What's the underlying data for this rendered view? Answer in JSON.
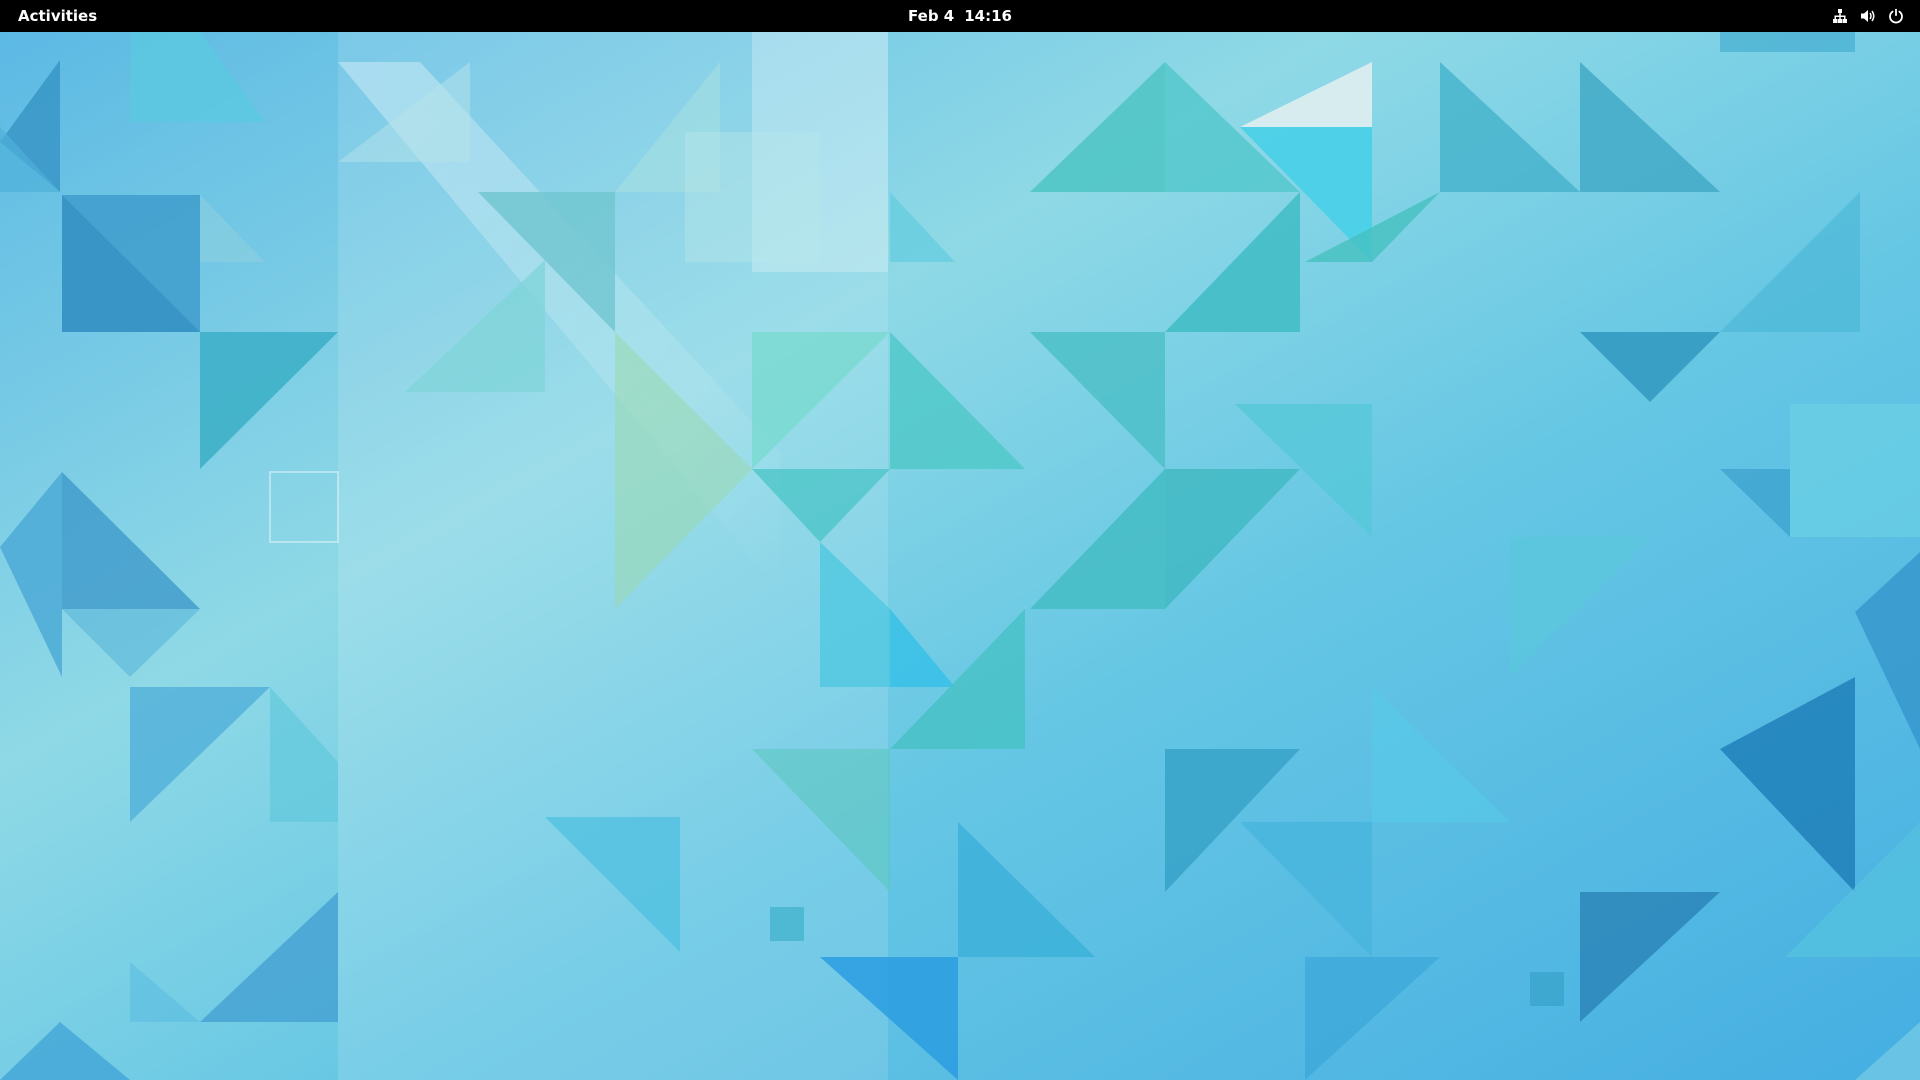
{
  "top_bar": {
    "activities_label": "Activities",
    "clock": {
      "date": "Feb 4",
      "time": "14:16"
    },
    "status_icons": [
      "network-wired-icon",
      "volume-icon",
      "power-icon"
    ]
  },
  "colors": {
    "top_bar": "#000000",
    "wallpaper_base": "#5fc0e0",
    "wallpaper_dark": "#2f94cf",
    "wallpaper_teal": "#40c0c0",
    "wallpaper_light": "#a8e0ec",
    "wallpaper_green": "#8fd6b4"
  }
}
